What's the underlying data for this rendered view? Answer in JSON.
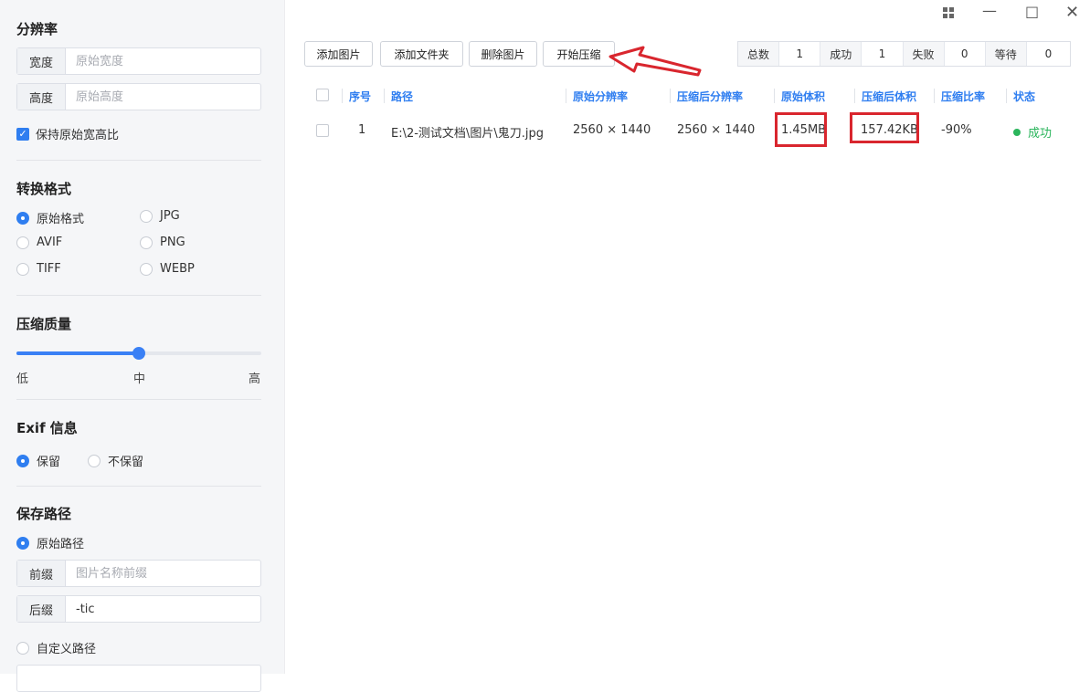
{
  "sidebar": {
    "resolution": {
      "title": "分辨率",
      "width_label": "宽度",
      "width_placeholder": "原始宽度",
      "height_label": "高度",
      "height_placeholder": "原始高度",
      "keep_ratio": "保持原始宽高比"
    },
    "format": {
      "title": "转换格式",
      "options": [
        "原始格式",
        "JPG",
        "AVIF",
        "PNG",
        "TIFF",
        "WEBP"
      ],
      "selected": "原始格式"
    },
    "quality": {
      "title": "压缩质量",
      "low": "低",
      "mid": "中",
      "high": "高",
      "value_fraction": 0.5
    },
    "exif": {
      "title": "Exif 信息",
      "keep": "保留",
      "discard": "不保留",
      "selected": "保留"
    },
    "save": {
      "title": "保存路径",
      "original_path": "原始路径",
      "prefix_label": "前缀",
      "prefix_placeholder": "图片名称前缀",
      "suffix_label": "后缀",
      "suffix_value": "-tic",
      "custom_path": "自定义路径"
    }
  },
  "toolbar": {
    "add_image": "添加图片",
    "add_folder": "添加文件夹",
    "delete_image": "删除图片",
    "start_compress": "开始压缩"
  },
  "stats": {
    "total_label": "总数",
    "total": "1",
    "success_label": "成功",
    "success": "1",
    "fail_label": "失败",
    "fail": "0",
    "wait_label": "等待",
    "wait": "0"
  },
  "table": {
    "headers": [
      "序号",
      "路径",
      "原始分辨率",
      "压缩后分辨率",
      "原始体积",
      "压缩后体积",
      "压缩比率",
      "状态"
    ],
    "rows": [
      {
        "index": "1",
        "path": "E:\\2-测试文档\\图片\\鬼刀.jpg",
        "orig_res": "2560 × 1440",
        "new_res": "2560 × 1440",
        "orig_size": "1.45MB",
        "new_size": "157.42KB",
        "ratio": "-90%",
        "status": "成功"
      }
    ]
  },
  "colors": {
    "accent": "#2f7ef0",
    "success": "#2bb55c",
    "highlight": "#d9262e"
  }
}
